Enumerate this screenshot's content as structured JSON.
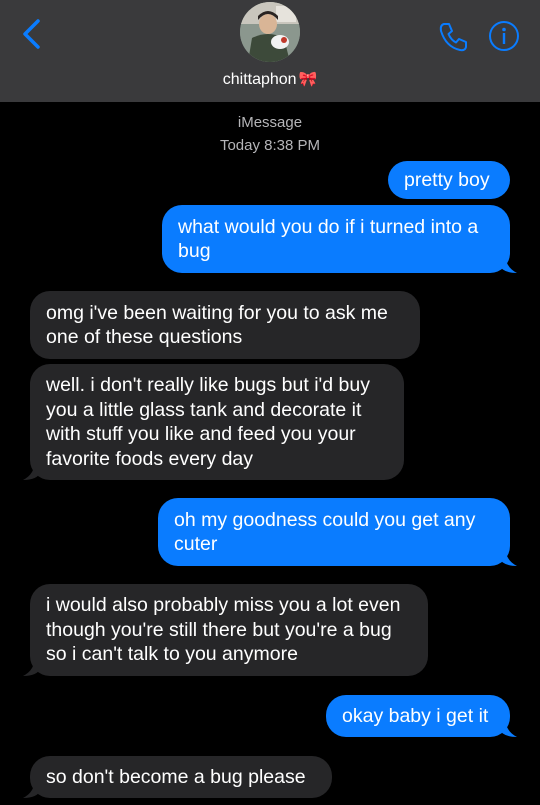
{
  "header": {
    "contact_name": "chittaphon",
    "name_emoji": "🎀",
    "back_icon": "chevron-left-icon",
    "call_icon": "phone-icon",
    "info_icon": "info-icon",
    "accent_color": "#0a7cff"
  },
  "thread": {
    "service": "iMessage",
    "timestamp": "Today 8:38 PM"
  },
  "messages": [
    {
      "from": "me",
      "text": "pretty boy"
    },
    {
      "from": "me",
      "text": "what would you do if i turned into a bug"
    },
    {
      "from": "them",
      "text": "omg i've been waiting for you to ask me one of these questions"
    },
    {
      "from": "them",
      "text": "well. i don't really like bugs but i'd buy you a little glass tank and decorate it with stuff you like and feed you your favorite foods every day"
    },
    {
      "from": "me",
      "text": "oh my goodness could you get any cuter"
    },
    {
      "from": "them",
      "text": "i would also probably miss you a lot even though you're still there but you're a bug so i can't talk to you anymore"
    },
    {
      "from": "me",
      "text": "okay baby i get it"
    },
    {
      "from": "them",
      "text": "so don't become a bug please"
    }
  ]
}
